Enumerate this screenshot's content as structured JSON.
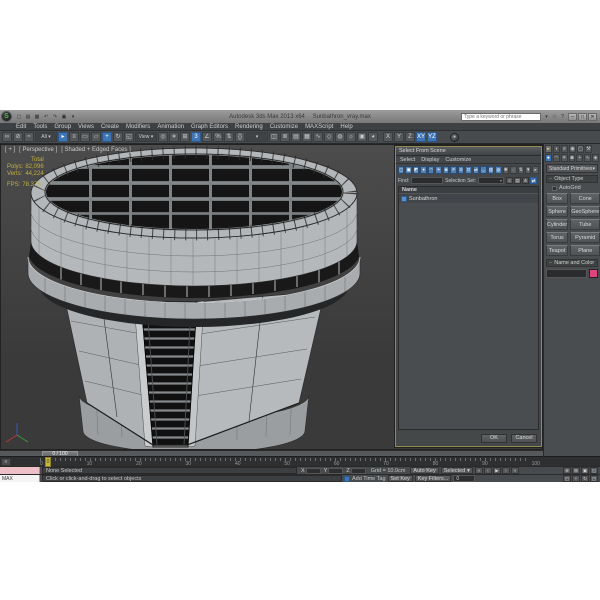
{
  "titlebar": {
    "logo_letter": "S",
    "title": "Autodesk 3ds Max 2013 x64",
    "document": "Sunbathron_vray.max",
    "search_placeholder": "Type a keyword or phrase",
    "quick_access": [
      {
        "n": "new-scene-icon",
        "g": "▢"
      },
      {
        "n": "open-file-icon",
        "g": "▤"
      },
      {
        "n": "save-file-icon",
        "g": "▦"
      },
      {
        "n": "undo-icon",
        "g": "↶"
      },
      {
        "n": "redo-icon",
        "g": "↷"
      },
      {
        "n": "project-folder-icon",
        "g": "▣"
      },
      {
        "n": "workspace-dropdown-icon",
        "g": "▾"
      }
    ],
    "infocenter_icons": [
      {
        "n": "search-icon",
        "g": "▾"
      },
      {
        "n": "favorites-star-icon",
        "g": "☆"
      },
      {
        "n": "help-icon",
        "g": "?"
      }
    ],
    "window_buttons": [
      {
        "n": "minimize-button",
        "g": "─"
      },
      {
        "n": "maximize-button",
        "g": "□"
      },
      {
        "n": "close-button",
        "g": "✕"
      }
    ]
  },
  "menu": {
    "items": [
      "Edit",
      "Tools",
      "Group",
      "Views",
      "Create",
      "Modifiers",
      "Animation",
      "Graph Editors",
      "Rendering",
      "Customize",
      "MAXScript",
      "Help"
    ]
  },
  "toolbar": {
    "icons": [
      {
        "n": "select-and-link",
        "g": "∞"
      },
      {
        "n": "unlink-selection",
        "g": "⊘"
      },
      {
        "n": "bind-to-space-warp",
        "g": "≈"
      },
      {
        "n": "selection-filter-dropdown",
        "g": "All ▾",
        "t": "dropdown"
      },
      {
        "n": "select-object",
        "g": "▸",
        "a": true
      },
      {
        "n": "select-by-name",
        "g": "≡"
      },
      {
        "n": "rectangular-selection-region",
        "g": "▭"
      },
      {
        "n": "window-crossing-toggle",
        "g": "▱"
      },
      {
        "n": "select-and-move",
        "g": "+",
        "a": true
      },
      {
        "n": "select-and-rotate",
        "g": "↻"
      },
      {
        "n": "select-and-scale",
        "g": "◱"
      },
      {
        "n": "reference-coordinate-dropdown",
        "g": "View ▾",
        "t": "dropdown"
      },
      {
        "n": "use-pivot-point-center",
        "g": "◎"
      },
      {
        "n": "select-and-manipulate",
        "g": "∗"
      },
      {
        "n": "keyboard-shortcut-override",
        "g": "⊞"
      },
      {
        "n": "snap-toggle-3d",
        "g": "3",
        "a": true
      },
      {
        "n": "angle-snap-toggle",
        "g": "∠"
      },
      {
        "n": "percent-snap-toggle",
        "g": "%"
      },
      {
        "n": "spinner-snap-toggle",
        "g": "⇅"
      },
      {
        "n": "edit-named-selection-sets",
        "g": "{}"
      },
      {
        "n": "named-selection-set-dropdown",
        "g": "▾",
        "t": "dropdown"
      },
      {
        "n": "mirror",
        "g": "◫"
      },
      {
        "n": "align",
        "g": "≣"
      },
      {
        "n": "layer-explorer",
        "g": "▤"
      },
      {
        "n": "graphite-ribbon-toggle",
        "g": "▦"
      },
      {
        "n": "curve-editor",
        "g": "∿"
      },
      {
        "n": "schematic-view",
        "g": "◇"
      },
      {
        "n": "material-editor",
        "g": "◍"
      },
      {
        "n": "render-setup",
        "g": "☼"
      },
      {
        "n": "rendered-frame-window",
        "g": "▣"
      },
      {
        "n": "render-production",
        "g": "◕"
      }
    ],
    "axis": [
      {
        "n": "axis-constraint-x",
        "g": "X"
      },
      {
        "n": "axis-constraint-y",
        "g": "Y"
      },
      {
        "n": "axis-constraint-z",
        "g": "Z"
      },
      {
        "n": "axis-constraint-xy",
        "g": "XY",
        "a": true
      },
      {
        "n": "axis-constraint-yz",
        "g": "YZ",
        "a": true
      }
    ],
    "render_round": "◕"
  },
  "viewport": {
    "label": [
      "[ + ]",
      "[ Perspective ]",
      "[ Shaded + Edged Faces ]"
    ],
    "stats": {
      "header": "Total",
      "rows": [
        {
          "label": "Polys:",
          "value": "82,096"
        },
        {
          "label": "Verts:",
          "value": "44,224"
        }
      ],
      "fps": {
        "label": "FPS:",
        "value": "78.376"
      }
    }
  },
  "dialog": {
    "title": "Select From Scene",
    "menus": [
      "Select",
      "Display",
      "Customize"
    ],
    "toolbar": [
      {
        "n": "display-all-icon",
        "g": "◻"
      },
      {
        "n": "display-none-icon",
        "g": "◼"
      },
      {
        "n": "display-invert-icon",
        "g": "◩"
      },
      {
        "n": "display-geometry-icon",
        "g": "●"
      },
      {
        "n": "display-shapes-icon",
        "g": "◠"
      },
      {
        "n": "display-lights-icon",
        "g": "☀"
      },
      {
        "n": "display-cameras-icon",
        "g": "◙"
      },
      {
        "n": "display-helpers-icon",
        "g": "#"
      },
      {
        "n": "display-spacewarps-icon",
        "g": "≋"
      },
      {
        "n": "display-groups-icon",
        "g": "⊡"
      },
      {
        "n": "display-xrefs-icon",
        "g": "⇄"
      },
      {
        "n": "display-bones-icon",
        "g": "◡"
      },
      {
        "n": "display-containers-icon",
        "g": "▥"
      },
      {
        "n": "display-materials-icon",
        "g": "◍"
      },
      {
        "n": "display-frozen-icon",
        "g": "✱",
        "gray": true
      },
      {
        "n": "display-hidden-icon",
        "g": "◌",
        "gray": true
      },
      {
        "n": "sort-icon",
        "g": "⇅",
        "gray": true
      },
      {
        "n": "filter-icon",
        "g": "▼",
        "gray": true
      },
      {
        "n": "pick-icon",
        "g": "▸",
        "gray": true
      }
    ],
    "find_label": "Find:",
    "selection_set_label": "Selection Set:",
    "view_buttons": [
      {
        "n": "view-list-icon",
        "g": "≡"
      },
      {
        "n": "view-detail-icon",
        "g": "▤"
      },
      {
        "n": "view-tree-icon",
        "g": "⋔"
      },
      {
        "n": "sync-selection-icon",
        "g": "⇄",
        "a": true
      }
    ],
    "column_header": "Name",
    "items": [
      {
        "name": "Sunbathron"
      }
    ],
    "ok": "OK",
    "cancel": "Cancel"
  },
  "command_panel": {
    "tabs": [
      {
        "n": "tab-create",
        "g": "▸",
        "a": true
      },
      {
        "n": "tab-modify",
        "g": "◗"
      },
      {
        "n": "tab-hierarchy",
        "g": "≡"
      },
      {
        "n": "tab-motion",
        "g": "◉"
      },
      {
        "n": "tab-display",
        "g": "▢"
      },
      {
        "n": "tab-utilities",
        "g": "⚒"
      }
    ],
    "categories": [
      {
        "n": "cat-geometry",
        "g": "●",
        "a": true
      },
      {
        "n": "cat-shapes",
        "g": "◠"
      },
      {
        "n": "cat-lights",
        "g": "☀"
      },
      {
        "n": "cat-cameras",
        "g": "◙"
      },
      {
        "n": "cat-helpers",
        "g": "+"
      },
      {
        "n": "cat-spacewarps",
        "g": "∿"
      },
      {
        "n": "cat-systems",
        "g": "◈"
      }
    ],
    "dropdown_value": "Standard Primitives",
    "object_type": {
      "title": "Object Type",
      "autogrid": "AutoGrid",
      "buttons": [
        "Box",
        "Cone",
        "Sphere",
        "GeoSphere",
        "Cylinder",
        "Tube",
        "Torus",
        "Pyramid",
        "Teapot",
        "Plane"
      ]
    },
    "name_color": {
      "title": "Name and Color",
      "value": "",
      "swatch_color": "#e0447f"
    }
  },
  "timeline": {
    "slider_value": "0 / 100",
    "marker_value": "0",
    "ticks": [
      "0",
      "10",
      "20",
      "30",
      "40",
      "50",
      "60",
      "70",
      "80",
      "90",
      "100"
    ]
  },
  "status": {
    "maxscript_label": "MAX",
    "selection_status": "None Selected",
    "prompt": "Click or click-and-drag to select objects",
    "coord_labels": [
      "X",
      "Y",
      "Z"
    ],
    "grid_label": "Grid = 10.0cm",
    "auto_key": "Auto Key",
    "selected_dropdown": "Selected",
    "set_key": "Set Key",
    "key_filters": "Key Filters...",
    "add_time_tag": "Add Time Tag",
    "time_value": "0",
    "playback": [
      {
        "n": "go-to-start-icon",
        "g": "«"
      },
      {
        "n": "previous-frame-icon",
        "g": "‹"
      },
      {
        "n": "play-icon",
        "g": "▶"
      },
      {
        "n": "next-frame-icon",
        "g": "›"
      },
      {
        "n": "go-to-end-icon",
        "g": "»"
      }
    ],
    "nav_row1": [
      {
        "n": "zoom-icon",
        "g": "⊕"
      },
      {
        "n": "zoom-all-icon",
        "g": "⊞"
      },
      {
        "n": "zoom-extents-icon",
        "g": "▣"
      },
      {
        "n": "field-of-view-icon",
        "g": "◱"
      }
    ],
    "nav_row2": [
      {
        "n": "zoom-region-icon",
        "g": "◰"
      },
      {
        "n": "pan-icon",
        "g": "+"
      },
      {
        "n": "orbit-icon",
        "g": "↻"
      },
      {
        "n": "maximize-viewport-toggle-icon",
        "g": "◳"
      }
    ]
  },
  "colors": {
    "accent_blue": "#3e75b5",
    "stats_yellow": "#bfae3c",
    "dialog_active_border": "#8f8a4d",
    "object_color_swatch": "#e0447f",
    "track_marker": "#c9ba3e"
  }
}
